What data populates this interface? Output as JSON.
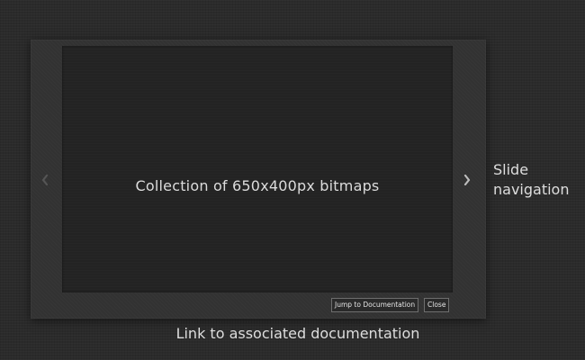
{
  "slideshow": {
    "slide_caption": "Collection of 650x400px bitmaps",
    "prev_icon": "chevron-left-icon",
    "next_icon": "chevron-right-icon",
    "jump_button_label": "Jump to Documentation",
    "close_button_label": "Close"
  },
  "annotations": {
    "slide_navigation": "Slide navigation",
    "documentation_link": "Link to associated documentation"
  },
  "colors": {
    "background": "#2b2b2b",
    "modal": "#323232",
    "slide": "#232323",
    "text": "#dcdcdc"
  }
}
